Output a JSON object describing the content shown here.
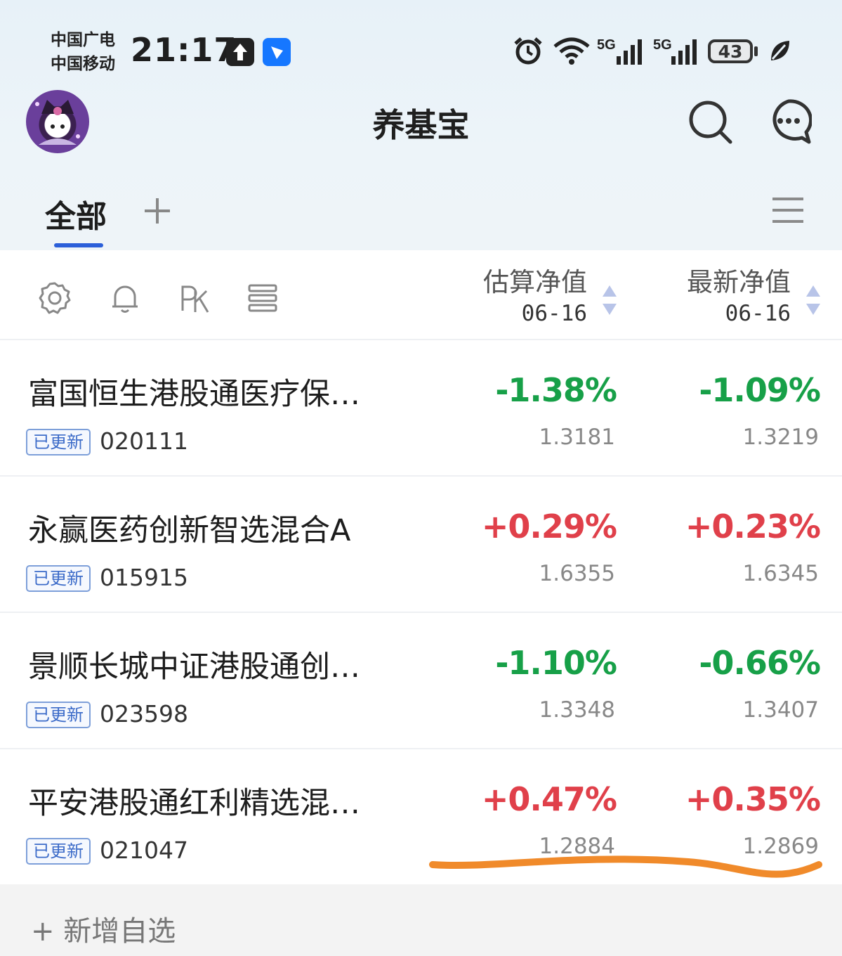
{
  "status_bar": {
    "carrier_line1": "中国广电",
    "carrier_line2": "中国移动",
    "time": "21:17",
    "net_label_1": "5G",
    "net_label_2": "5G",
    "battery": "43",
    "icons": [
      "upload-icon",
      "alipay-icon",
      "alarm-icon",
      "wifi-icon",
      "signal-icon",
      "leaf-icon"
    ]
  },
  "header": {
    "title": "养基宝",
    "icons": [
      "avatar",
      "search-icon",
      "message-icon"
    ]
  },
  "tabs": {
    "active": "全部",
    "add_icon": "plus-icon",
    "menu_icon": "menu-icon"
  },
  "toolbar": {
    "icons": [
      "settings-icon",
      "bell-icon",
      "pk-icon",
      "list-icon"
    ],
    "col1_title": "估算净值",
    "col1_date": "06-16",
    "col2_title": "最新净值",
    "col2_date": "06-16"
  },
  "funds": [
    {
      "name": "富国恒生港股通医疗保…",
      "badge": "已更新",
      "code": "020111",
      "est_pct": "-1.38%",
      "est_nav": "1.3181",
      "latest_pct": "-1.09%",
      "latest_nav": "1.3219"
    },
    {
      "name": "永赢医药创新智选混合A",
      "badge": "已更新",
      "code": "015915",
      "est_pct": "+0.29%",
      "est_nav": "1.6355",
      "latest_pct": "+0.23%",
      "latest_nav": "1.6345"
    },
    {
      "name": "景顺长城中证港股通创…",
      "badge": "已更新",
      "code": "023598",
      "est_pct": "-1.10%",
      "est_nav": "1.3348",
      "latest_pct": "-0.66%",
      "latest_nav": "1.3407"
    },
    {
      "name": "平安港股通红利精选混…",
      "badge": "已更新",
      "code": "021047",
      "est_pct": "+0.47%",
      "est_nav": "1.2884",
      "latest_pct": "+0.35%",
      "latest_nav": "1.2869"
    }
  ],
  "footer": {
    "add_label": "+ 新增自选"
  },
  "colors": {
    "up": "#e0404a",
    "down": "#17a048",
    "accent": "#2b5fd9",
    "annotation": "#f08a2a"
  }
}
